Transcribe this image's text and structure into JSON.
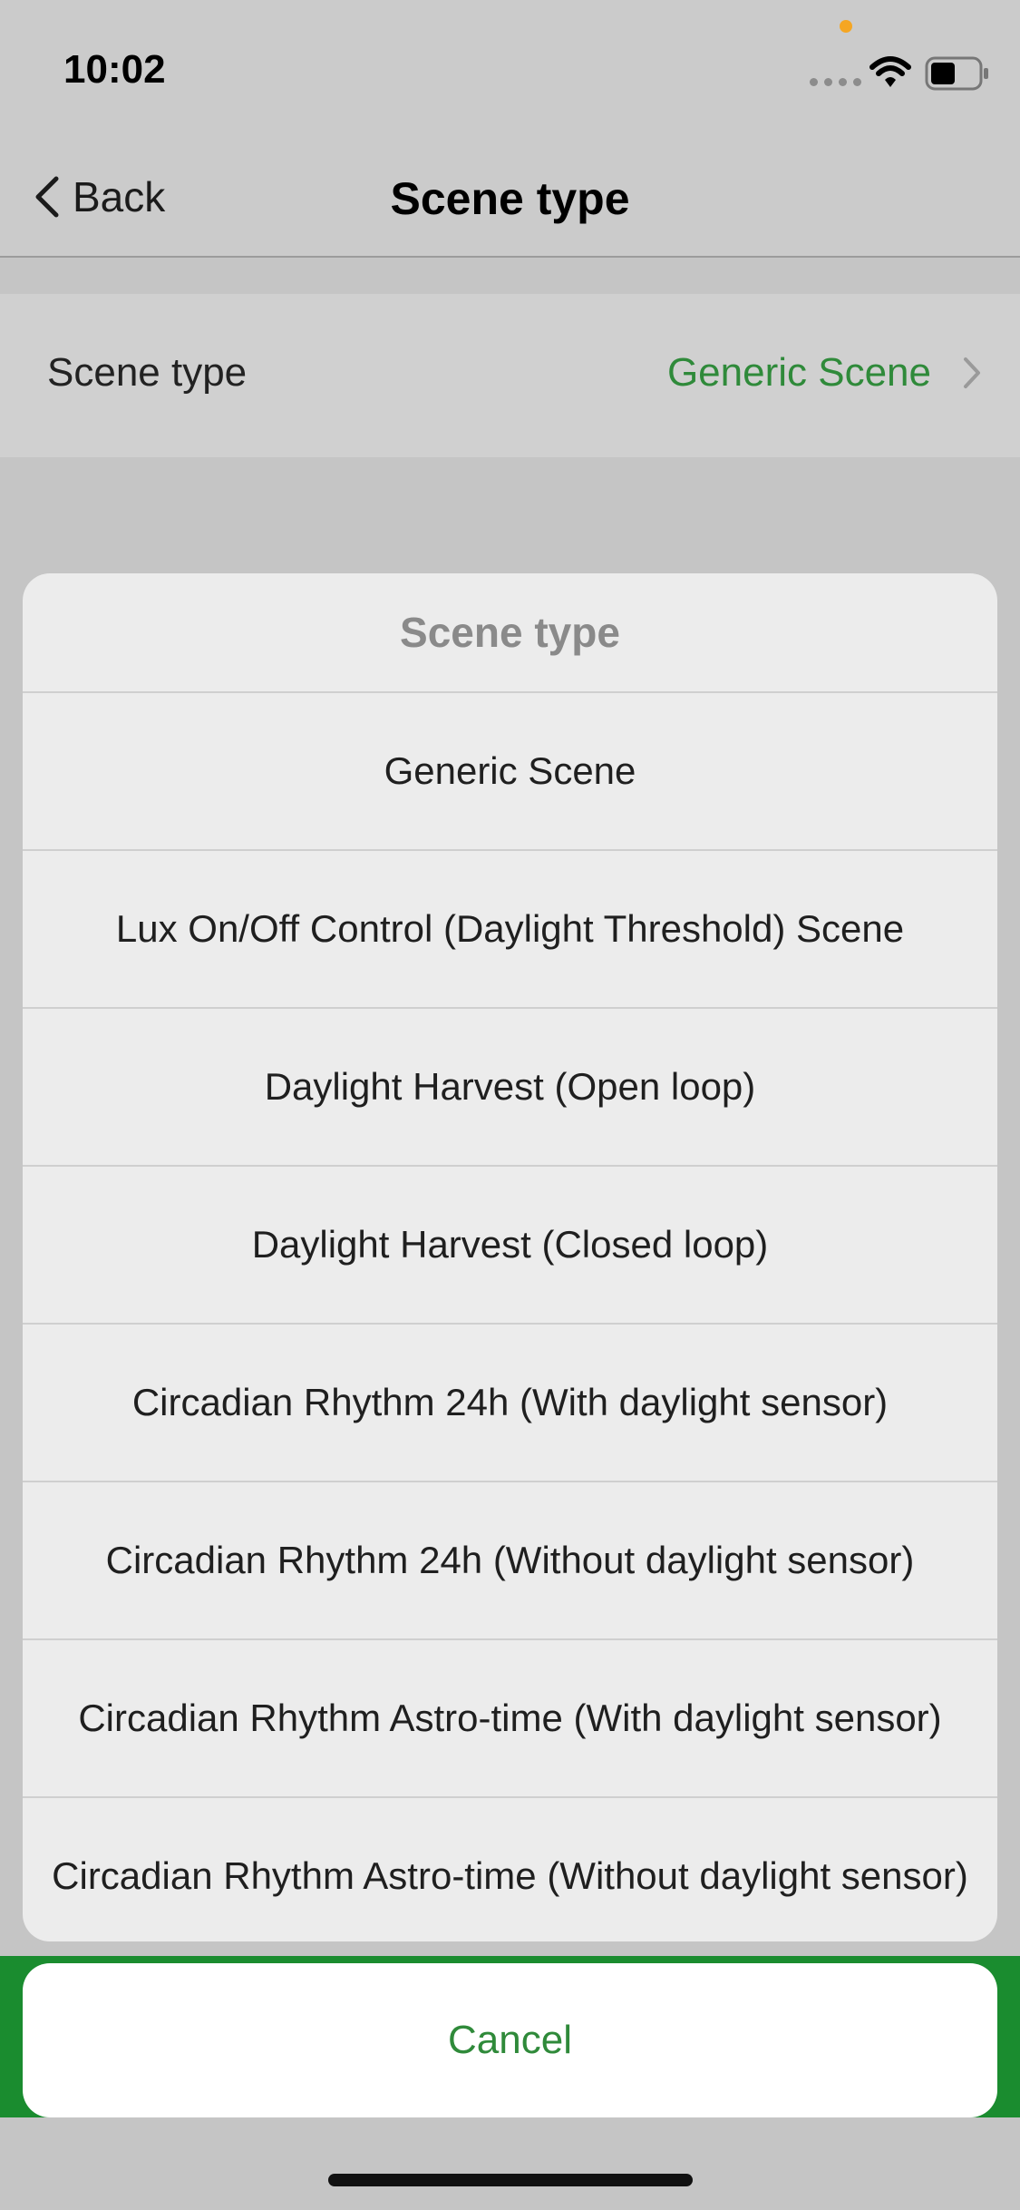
{
  "status_bar": {
    "time": "10:02",
    "icons": [
      "signal-dots-icon",
      "wifi-icon",
      "battery-icon"
    ],
    "indicator_color": "#f5a623"
  },
  "nav": {
    "back_label": "Back",
    "title": "Scene type"
  },
  "setting_row": {
    "label": "Scene type",
    "value": "Generic Scene"
  },
  "action_sheet": {
    "title": "Scene type",
    "options": [
      "Generic Scene",
      "Lux On/Off Control (Daylight Threshold) Scene",
      "Daylight Harvest (Open loop)",
      "Daylight Harvest (Closed loop)",
      "Circadian Rhythm 24h (With daylight sensor)",
      "Circadian Rhythm 24h (Without daylight sensor)",
      "Circadian Rhythm Astro-time (With daylight sensor)",
      "Circadian Rhythm Astro-time (Without daylight sensor)"
    ],
    "cancel_label": "Cancel"
  },
  "colors": {
    "accent_green": "#2f8a3a",
    "bottom_strip_green": "#1a8c2f"
  }
}
